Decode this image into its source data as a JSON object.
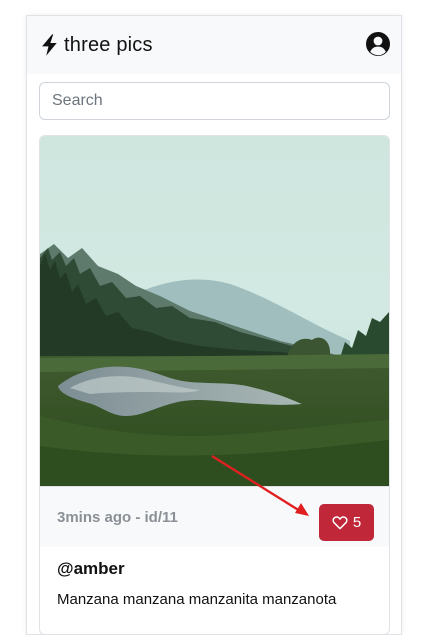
{
  "app": {
    "brand": "three pics"
  },
  "search": {
    "placeholder": "Search"
  },
  "post": {
    "meta": "3mins ago - id/11",
    "likes": "5",
    "author": "@amber",
    "caption": "Manzana manzana manzanita manzanota"
  },
  "icons": {
    "brand": "lightning-bolt-icon",
    "user": "user-circle-icon",
    "like": "heart-outline-icon"
  },
  "colors": {
    "like_button": "#c0283a",
    "annotation_arrow": "#e02020"
  }
}
